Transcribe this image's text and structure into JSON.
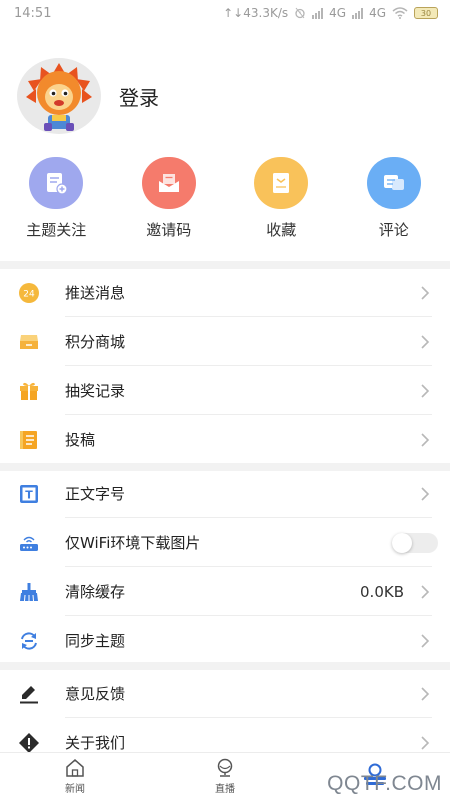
{
  "status_bar": {
    "time": "14:51",
    "net_speed": "43.3K/s",
    "network_1": "4G",
    "network_2": "4G",
    "battery": "30"
  },
  "profile": {
    "login_label": "登录"
  },
  "quick_actions": [
    {
      "label": "主题关注",
      "icon": "topic-follow-icon",
      "color": "#9fa8ee"
    },
    {
      "label": "邀请码",
      "icon": "invite-code-icon",
      "color": "#f57b6c"
    },
    {
      "label": "收藏",
      "icon": "favorites-icon",
      "color": "#f9c25a"
    },
    {
      "label": "评论",
      "icon": "comments-icon",
      "color": "#6aaef5"
    }
  ],
  "menu": {
    "push": "推送消息",
    "points_mall": "积分商城",
    "lottery": "抽奖记录",
    "submit": "投稿",
    "font_size": "正文字号",
    "wifi_images": "仅WiFi环境下载图片",
    "clear_cache": "清除缓存",
    "cache_size": "0.0KB",
    "sync_topics": "同步主题",
    "feedback": "意见反馈",
    "about": "关于我们"
  },
  "bottom_nav": {
    "news": "新闻",
    "live": "直播"
  },
  "watermark": "QQTF.COM"
}
